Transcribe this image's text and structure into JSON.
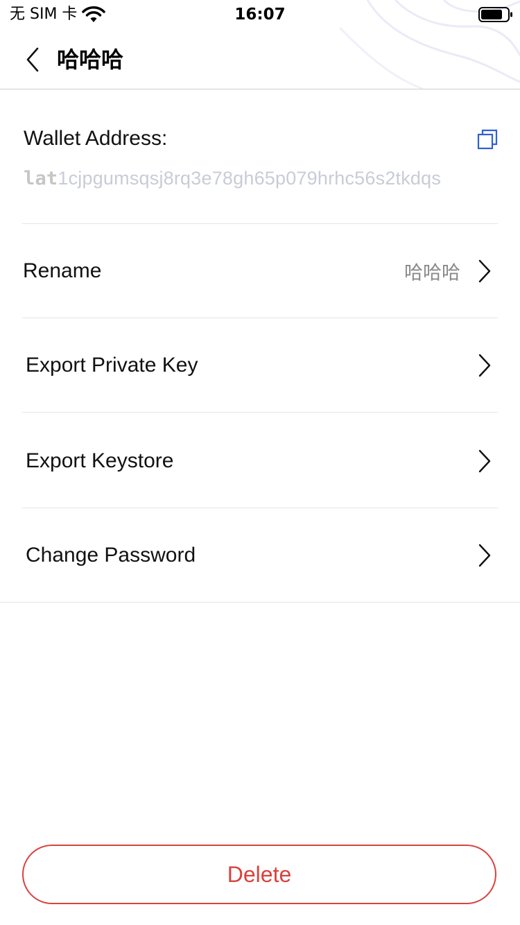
{
  "status_bar": {
    "carrier": "无 SIM 卡",
    "time": "16:07"
  },
  "nav": {
    "title": "哈哈哈",
    "back_icon": "chevron-left-icon"
  },
  "wallet": {
    "address_label": "Wallet Address:",
    "address_prefix": "lat",
    "address_rest": "1cjpgumsqsj8rq3e78gh65p079hrhc56s2tkdqs",
    "copy_icon": "copy-icon",
    "copy_color": "#2f5fd6"
  },
  "rows": [
    {
      "label": "Rename",
      "value": "哈哈哈"
    },
    {
      "label": "Export Private Key"
    },
    {
      "label": "Export Keystore"
    },
    {
      "label": "Change Password"
    }
  ],
  "delete_label": "Delete",
  "colors": {
    "danger": "#d9423d",
    "address_text": "#c8ccd6"
  }
}
